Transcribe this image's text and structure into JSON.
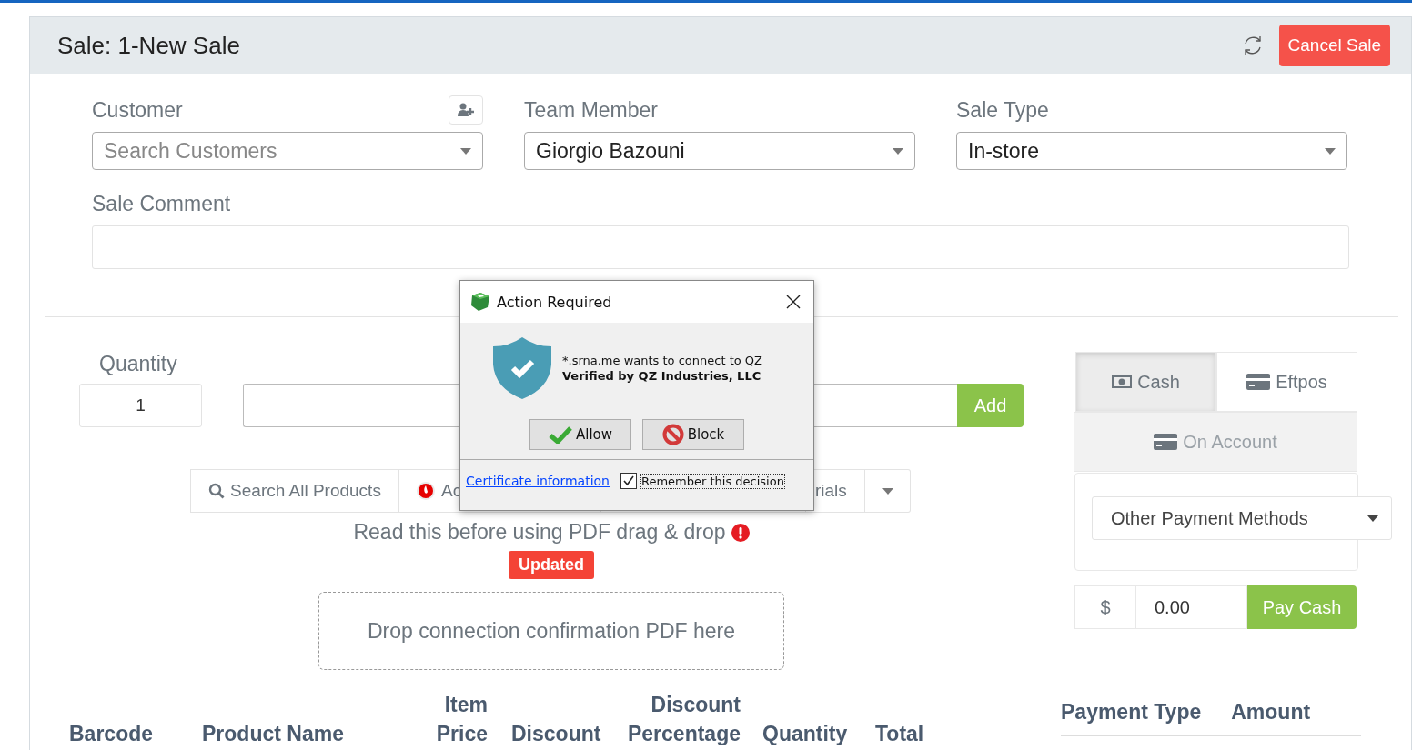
{
  "header": {
    "title": "Sale: 1-New Sale",
    "cancel_button": "Cancel Sale"
  },
  "fields": [
    {
      "label": "Customer",
      "kind": "select",
      "placeholder": "Search Customers",
      "add_customer": true
    },
    {
      "label": "Team Member",
      "kind": "select",
      "value": "Giorgio Bazouni"
    },
    {
      "label": "Sale Type",
      "kind": "select",
      "value": "In-store"
    }
  ],
  "sale_comment": {
    "label": "Sale Comment"
  },
  "quantity": {
    "label": "Quantity",
    "value": "1"
  },
  "add_button": "Add",
  "product_tabs": [
    {
      "label": "Search All Products",
      "kind": "search"
    },
    {
      "label": "Ac",
      "kind": "brand"
    },
    {
      "kind": "hidden"
    },
    {
      "label": "rials",
      "kind": "plain"
    },
    {
      "kind": "caret"
    }
  ],
  "pdf_notice": {
    "text": "Read this before using PDF drag & drop",
    "badge": "Updated"
  },
  "drop_zone": "Drop connection confirmation PDF here",
  "table": {
    "columns": [
      [
        "Barcode"
      ],
      [
        "Product Name"
      ],
      [
        "Item",
        "Price"
      ],
      [
        "Discount"
      ],
      [
        "Discount",
        "Percentage"
      ],
      [
        "Quantity"
      ],
      [
        "Total"
      ]
    ]
  },
  "payment_tabs": [
    {
      "label": "Cash",
      "kind": "cash",
      "selected": true,
      "disabled": false
    },
    {
      "label": "Eftpos",
      "kind": "card",
      "selected": false,
      "disabled": false
    },
    {
      "label": "On Account",
      "kind": "card",
      "selected": false,
      "disabled": true
    }
  ],
  "other_payment": "Other Payment Methods",
  "amount": {
    "currency": "$",
    "value": "0.00",
    "button": "Pay Cash"
  },
  "payments_table": {
    "columns": [
      "Payment Type",
      "Amount"
    ]
  },
  "dialog": {
    "title": "Action Required",
    "message": "*.srna.me wants to connect to QZ",
    "verified": "Verified by QZ Industries, LLC",
    "allow": "Allow",
    "block": "Block",
    "link": "Certificate information",
    "remember": "Remember this decision",
    "remember_checked": true
  }
}
